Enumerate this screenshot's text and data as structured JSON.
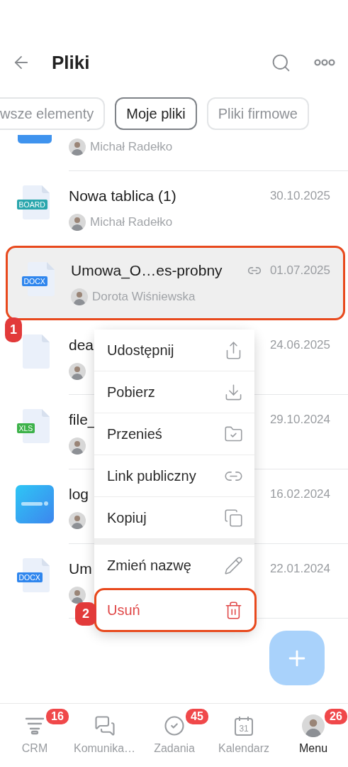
{
  "header": {
    "title": "Pliki"
  },
  "filters": [
    {
      "label": "wsze elementy",
      "selected": false
    },
    {
      "label": "Moje pliki",
      "selected": true
    },
    {
      "label": "Pliki firmowe",
      "selected": false
    }
  ],
  "files": [
    {
      "kind": "partial",
      "author": "Michał Radełko",
      "selected": false
    },
    {
      "kind": "doc",
      "badge": "BOARD",
      "color": "#2aa6ad",
      "name": "Nowa tablica (1)",
      "date": "30.10.2025",
      "author": "Michał Radełko",
      "shared": false,
      "selected": false
    },
    {
      "kind": "doc",
      "badge": "DOCX",
      "color": "#2f86ee",
      "name": "Umowa_O…es-probny",
      "date": "01.07.2025",
      "author": "Dorota Wiśniewska",
      "shared": true,
      "selected": true
    },
    {
      "kind": "blank",
      "name": "dea",
      "date": "24.06.2025",
      "shared": false,
      "selected": false
    },
    {
      "kind": "doc",
      "badge": "XLS",
      "color": "#3db24a",
      "name": "file_",
      "date": "29.10.2024",
      "shared": false,
      "selected": false
    },
    {
      "name": "log",
      "date": "16.02.2024",
      "shared": false,
      "selected": false
    },
    {
      "kind": "doc",
      "badge": "DOCX",
      "color": "#2f86ee",
      "name": "Um",
      "date": "22.01.2024",
      "shared": false,
      "selected": false
    }
  ],
  "menu": {
    "groups": [
      [
        {
          "label": "Udostępnij",
          "kind": "normal",
          "highlighted": false
        },
        {
          "label": "Pobierz",
          "kind": "normal",
          "highlighted": false
        },
        {
          "label": "Przenieś",
          "kind": "normal",
          "highlighted": false
        },
        {
          "label": "Link publiczny",
          "kind": "normal",
          "highlighted": false
        },
        {
          "label": "Kopiuj",
          "kind": "normal",
          "highlighted": false
        }
      ],
      [
        {
          "label": "Zmień nazwę",
          "kind": "normal",
          "highlighted": false
        }
      ],
      [
        {
          "label": "Usuń",
          "kind": "danger",
          "highlighted": true
        }
      ]
    ]
  },
  "callouts": [
    {
      "label": "1"
    },
    {
      "label": "2"
    }
  ],
  "nav": [
    {
      "label": "CRM",
      "badge": "16",
      "selected": false
    },
    {
      "label": "Komunika…",
      "selected": false
    },
    {
      "label": "Zadania",
      "badge": "45",
      "selected": false
    },
    {
      "label": "Kalendarz",
      "calendar_day": "31",
      "selected": false
    },
    {
      "label": "Menu",
      "badge": "26",
      "selected": true
    }
  ]
}
